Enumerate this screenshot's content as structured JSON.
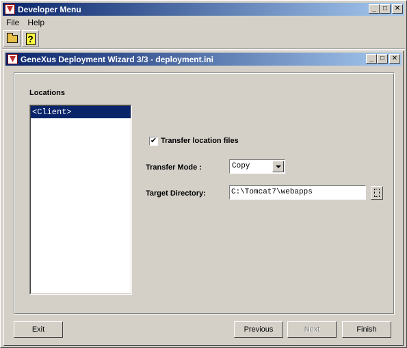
{
  "main_window": {
    "title": "Developer Menu"
  },
  "menu": {
    "file": "File",
    "help": "Help"
  },
  "toolbar": {
    "open_icon": "folder-open-icon",
    "help_icon": "help-icon",
    "help_glyph": "?"
  },
  "title_buttons": {
    "minimize": "_",
    "maximize": "□",
    "close": "✕"
  },
  "wizard": {
    "title": "GeneXus Deployment Wizard 3/3 - deployment.ini",
    "locations_label": "Locations",
    "locations": [
      {
        "label": "<Client>",
        "selected": true
      }
    ],
    "transfer_location_files_label": "Transfer location files",
    "transfer_location_files_checked": "✔",
    "transfer_mode_label": "Transfer Mode :",
    "transfer_mode_value": "Copy",
    "target_directory_label": "Target Directory:",
    "target_directory_value": "C:\\Tomcat7\\webapps",
    "buttons": {
      "exit": "Exit",
      "previous": "Previous",
      "next": "Next",
      "finish": "Finish"
    }
  }
}
